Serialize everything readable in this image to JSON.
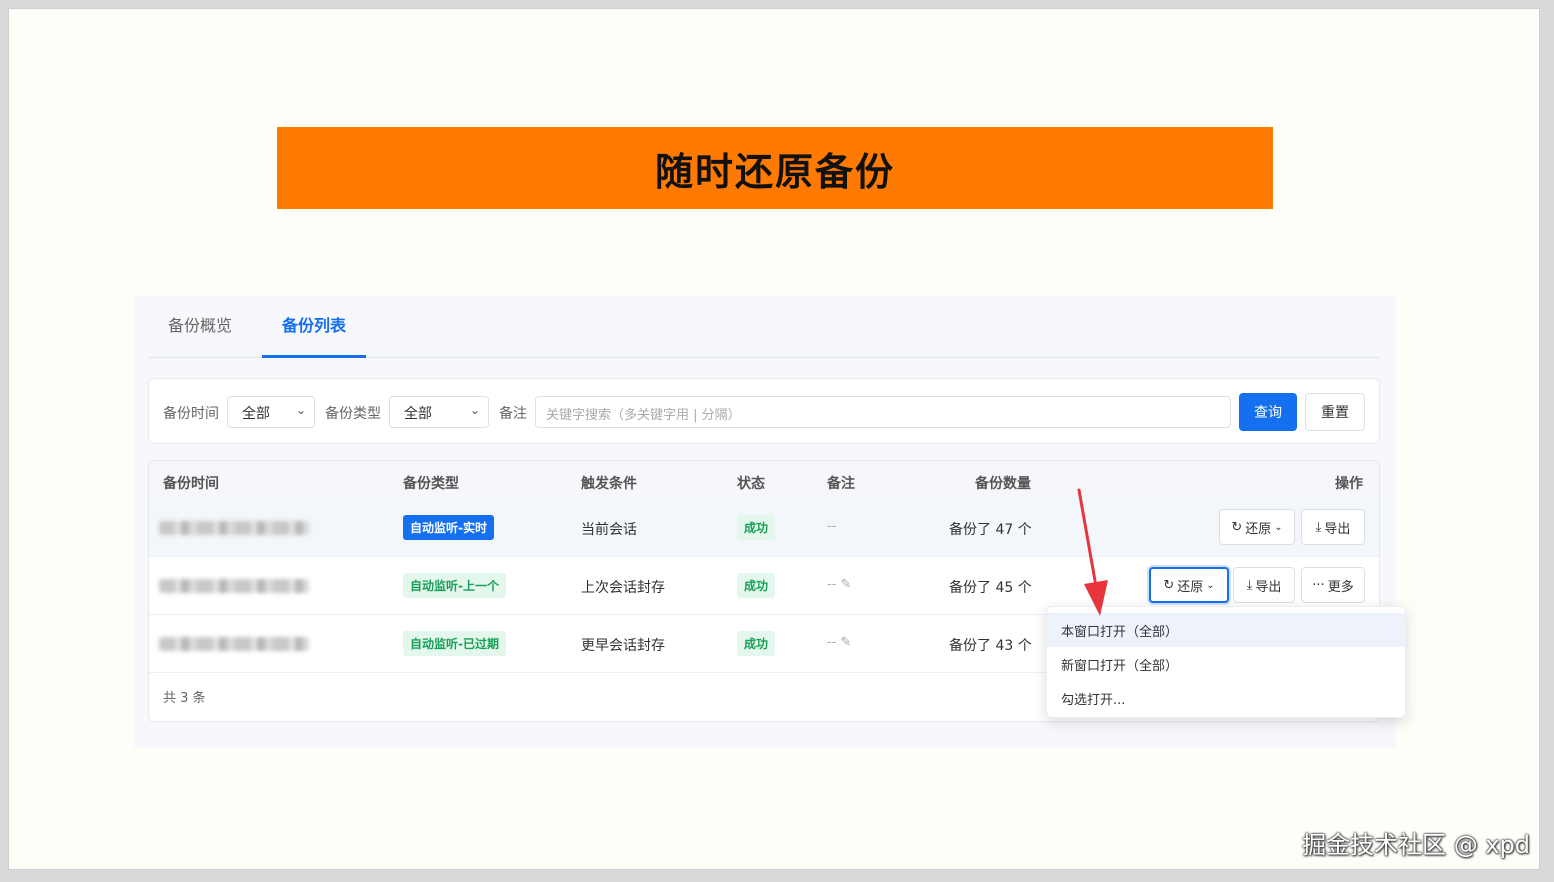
{
  "slide": {
    "title": "随时还原备份",
    "watermark": "掘金技术社区 @ xpd"
  },
  "tabs": [
    {
      "label": "备份概览"
    },
    {
      "label": "备份列表"
    }
  ],
  "filters": {
    "time_label": "备份时间",
    "time_value": "全部",
    "type_label": "备份类型",
    "type_value": "全部",
    "note_label": "备注",
    "note_placeholder": "关键字搜索（多关键字用 | 分隔）",
    "query_button": "查询",
    "reset_button": "重置"
  },
  "table": {
    "headers": [
      "备份时间",
      "备份类型",
      "触发条件",
      "状态",
      "备注",
      "备份数量",
      "操作"
    ],
    "rows": [
      {
        "type": "自动监听-实时",
        "trigger": "当前会话",
        "status": "成功",
        "note": "--",
        "count": "备份了 47 个"
      },
      {
        "type": "自动监听-上一个",
        "trigger": "上次会话封存",
        "status": "成功",
        "note": "--",
        "count": "备份了 45 个"
      },
      {
        "type": "自动监听-已过期",
        "trigger": "更早会话封存",
        "status": "成功",
        "note": "--",
        "count": "备份了 43 个"
      }
    ],
    "actions": {
      "restore": "还原",
      "export": "导出",
      "more": "更多"
    },
    "total": "共 3 条"
  },
  "dropdown": {
    "items": [
      {
        "label": "本窗口打开（全部）"
      },
      {
        "label": "新窗口打开（全部）"
      },
      {
        "label": "勾选打开..."
      }
    ]
  },
  "colors": {
    "accent": "#1570ef",
    "banner": "#ff7a00",
    "success": "#18a058",
    "arrow": "#e8343b"
  },
  "icons": [
    "restore-icon",
    "chevron-down-icon",
    "download-icon",
    "more-icon",
    "edit-pencil-icon"
  ]
}
